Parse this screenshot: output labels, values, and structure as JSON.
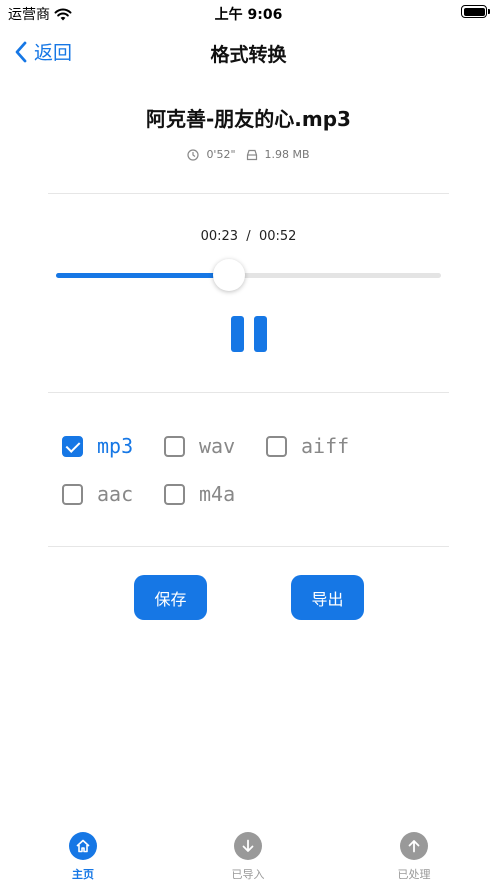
{
  "status_bar": {
    "carrier": "运营商",
    "time": "上午 9:06",
    "battery_level": 1.0
  },
  "nav": {
    "back_label": "返回",
    "title": "格式转换"
  },
  "file": {
    "name": "阿克善-朋友的心.mp3",
    "duration": "0'52\"",
    "size": "1.98 MB"
  },
  "player": {
    "current": "00:23",
    "separator": "/",
    "total": "00:52",
    "progress": 0.45,
    "state": "playing"
  },
  "formats": [
    {
      "label": "mp3",
      "checked": true
    },
    {
      "label": "wav",
      "checked": false
    },
    {
      "label": "aiff",
      "checked": false
    },
    {
      "label": "aac",
      "checked": false
    },
    {
      "label": "m4a",
      "checked": false
    }
  ],
  "actions": {
    "save_label": "保存",
    "export_label": "导出"
  },
  "tabs": [
    {
      "label": "主页",
      "icon": "home-icon",
      "active": true
    },
    {
      "label": "已导入",
      "icon": "arrow-down-icon",
      "active": false
    },
    {
      "label": "已处理",
      "icon": "arrow-up-icon",
      "active": false
    }
  ],
  "colors": {
    "accent": "#1677e5",
    "inactive": "#999999"
  }
}
